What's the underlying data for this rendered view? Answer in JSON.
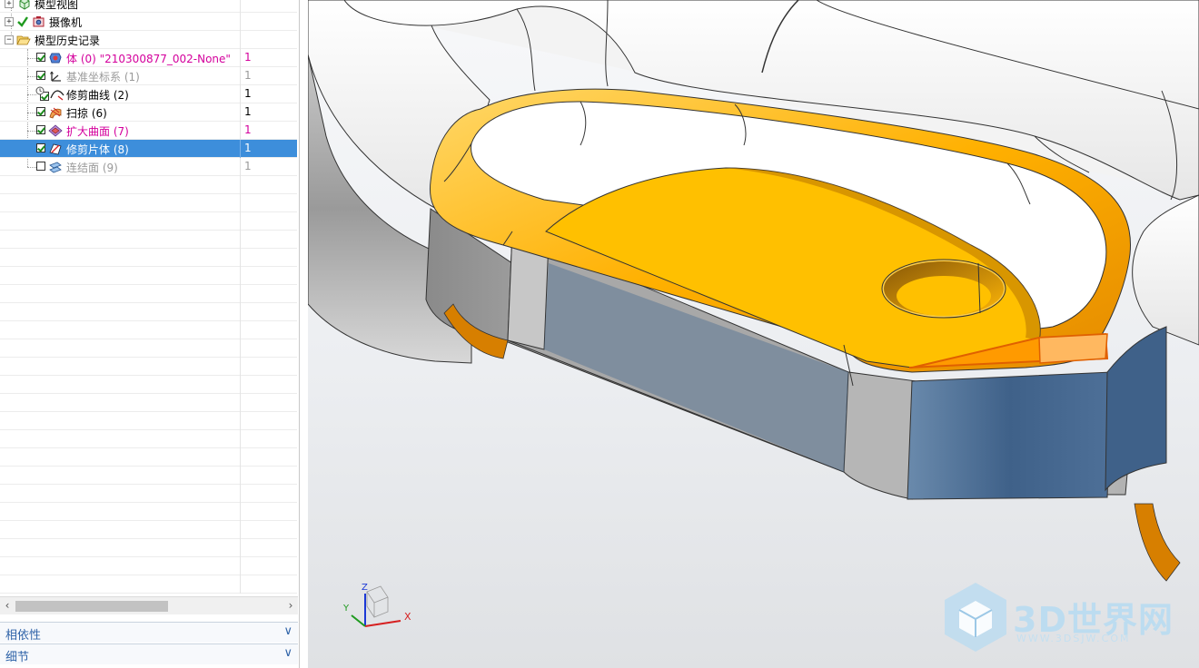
{
  "navigator": {
    "nodes": {
      "model_views": {
        "label": "模型视图"
      },
      "cameras": {
        "label": "摄像机"
      },
      "history": {
        "label": "模型历史记录"
      }
    },
    "history_items": [
      {
        "label": "体 (0) \"210300877_002-None\"",
        "value": "1",
        "checked": true,
        "color": "magenta"
      },
      {
        "label": "基准坐标系 (1)",
        "value": "1",
        "checked": true,
        "color": "gray"
      },
      {
        "label": "修剪曲线 (2)",
        "value": "1",
        "checked": true,
        "color": "normal"
      },
      {
        "label": "扫掠 (6)",
        "value": "1",
        "checked": true,
        "color": "normal"
      },
      {
        "label": "扩大曲面 (7)",
        "value": "1",
        "checked": true,
        "color": "magenta"
      },
      {
        "label": "修剪片体 (8)",
        "value": "1",
        "checked": true,
        "color": "selected"
      },
      {
        "label": "连结面 (9)",
        "value": "1",
        "checked": false,
        "color": "gray"
      }
    ],
    "panels": {
      "dependencies": "相依性",
      "details": "细节"
    }
  },
  "viewport": {
    "triad": {
      "x": "X",
      "y": "Y",
      "z": "Z"
    },
    "watermark": {
      "brand": "3D世界网",
      "url": "WWW.3DSJW.COM"
    }
  },
  "colors": {
    "selection": "#3d8edb",
    "magenta_text": "#d4009c",
    "highlight_orange": "#ffc000",
    "blue_face": "#4a6a8e",
    "panel_text": "#2f63a8"
  }
}
